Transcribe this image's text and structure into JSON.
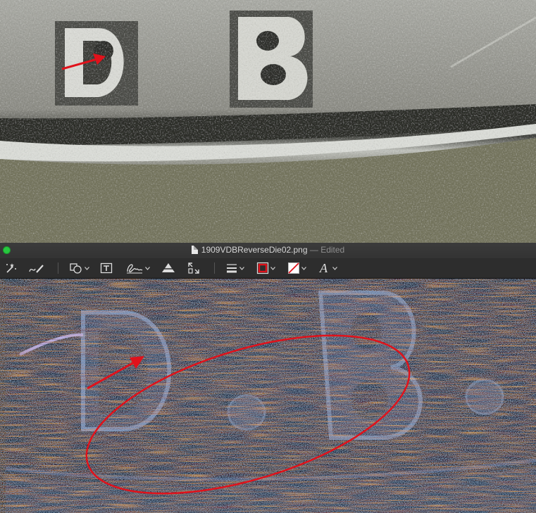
{
  "window": {
    "filename": "1909VDBReverseDie02.png",
    "status": "— Edited"
  },
  "toolbar": {
    "tools": [
      {
        "name": "instant-alpha-tool",
        "icon": "magic-wand-icon"
      },
      {
        "name": "sketch-tool",
        "icon": "sketch-pen-icon"
      },
      {
        "name": "shapes-menu",
        "icon": "shapes-icon"
      },
      {
        "name": "text-tool",
        "icon": "text-box-icon"
      },
      {
        "name": "sign-menu",
        "icon": "signature-icon"
      },
      {
        "name": "adjust-color-tool",
        "icon": "adjust-color-icon"
      },
      {
        "name": "adjust-size-tool",
        "icon": "resize-icon"
      },
      {
        "name": "line-style-menu",
        "icon": "line-style-icon"
      },
      {
        "name": "border-color-menu",
        "icon": "border-color-icon"
      },
      {
        "name": "fill-color-menu",
        "icon": "fill-color-icon"
      },
      {
        "name": "text-style-menu",
        "icon": "text-style-icon"
      }
    ],
    "text_style_glyph": "A"
  },
  "colors": {
    "annotation_red": "#e0121b",
    "traffic_green": "#27c93f",
    "toolbar_bg": "#2d2d2d"
  },
  "photos": {
    "top": {
      "subject": "coin-letters-d-b-silver",
      "letters": [
        "D",
        "B"
      ]
    },
    "bottom": {
      "subject": "coin-letters-d-b-toned",
      "letters": [
        "D",
        "B"
      ]
    }
  }
}
